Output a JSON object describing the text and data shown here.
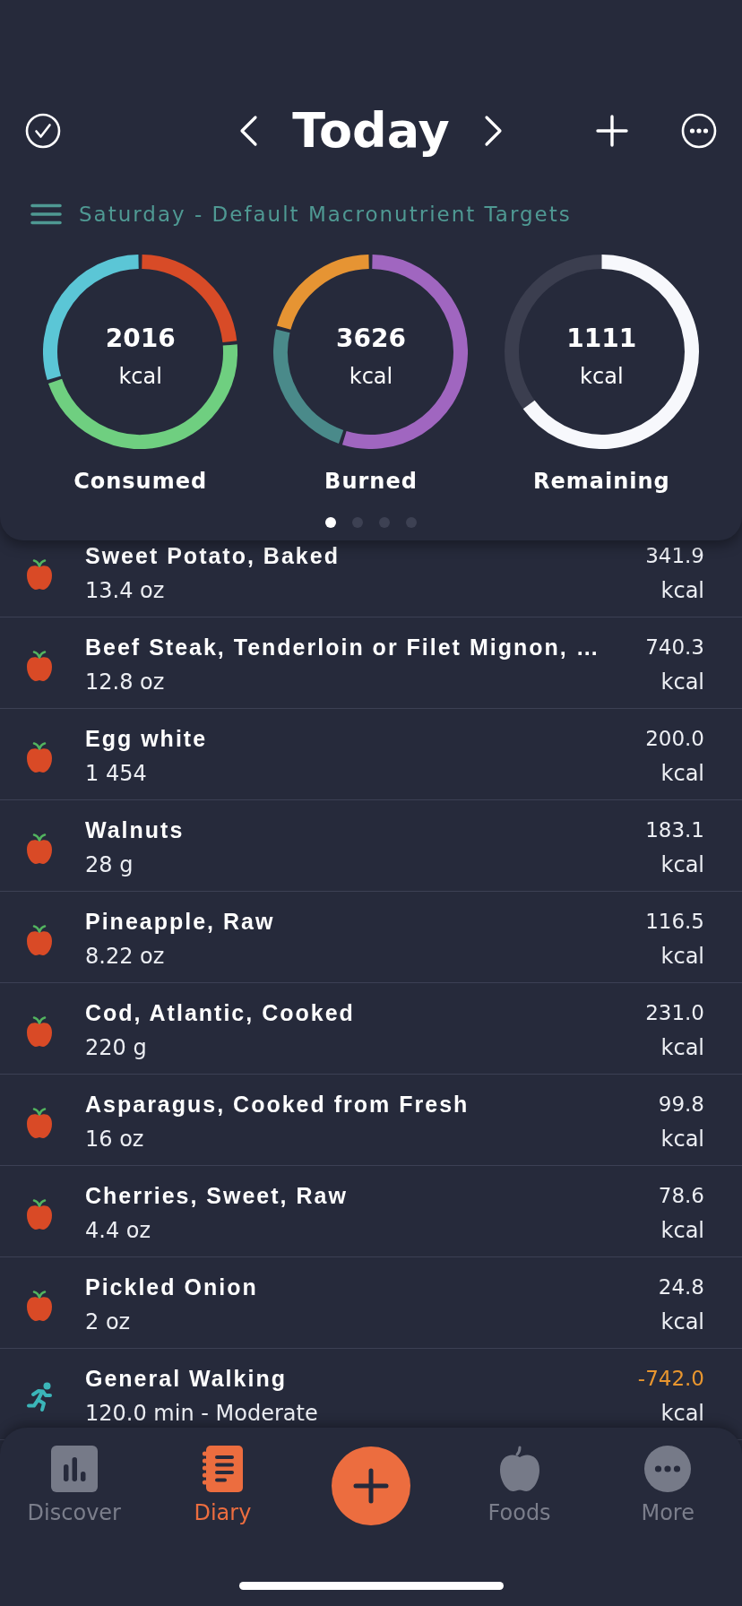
{
  "header": {
    "title": "Today",
    "subtitle": "Saturday - Default Macronutrient Targets"
  },
  "rings": [
    {
      "value": "2016",
      "unit": "kcal",
      "label": "Consumed"
    },
    {
      "value": "3626",
      "unit": "kcal",
      "label": "Burned"
    },
    {
      "value": "1111",
      "unit": "kcal",
      "label": "Remaining"
    }
  ],
  "pager": [
    {
      "selected": true
    },
    {
      "selected": false
    },
    {
      "selected": false
    },
    {
      "selected": false
    }
  ],
  "entries": [
    {
      "kind": "food",
      "name": "Sweet Potato, Baked",
      "amount": "13.4 oz",
      "calories": "341.9",
      "unit": "kcal"
    },
    {
      "kind": "food",
      "name": "Beef Steak, Tenderloin or Filet Mignon, …",
      "amount": "12.8 oz",
      "calories": "740.3",
      "unit": "kcal"
    },
    {
      "kind": "food",
      "name": "Egg white",
      "amount": "1 454",
      "calories": "200.0",
      "unit": "kcal"
    },
    {
      "kind": "food",
      "name": "Walnuts",
      "amount": "28 g",
      "calories": "183.1",
      "unit": "kcal"
    },
    {
      "kind": "food",
      "name": "Pineapple, Raw",
      "amount": "8.22 oz",
      "calories": "116.5",
      "unit": "kcal"
    },
    {
      "kind": "food",
      "name": "Cod, Atlantic, Cooked",
      "amount": "220 g",
      "calories": "231.0",
      "unit": "kcal"
    },
    {
      "kind": "food",
      "name": "Asparagus, Cooked from Fresh",
      "amount": "16 oz",
      "calories": "99.8",
      "unit": "kcal"
    },
    {
      "kind": "food",
      "name": "Cherries, Sweet, Raw",
      "amount": "4.4 oz",
      "calories": "78.6",
      "unit": "kcal"
    },
    {
      "kind": "food",
      "name": "Pickled Onion",
      "amount": "2 oz",
      "calories": "24.8",
      "unit": "kcal"
    },
    {
      "kind": "exercise",
      "name": "General Walking",
      "amount": "120.0 min - Moderate",
      "calories": "-742.0",
      "unit": "kcal"
    }
  ],
  "nav": {
    "items": [
      {
        "kind": "tab",
        "label": "Discover",
        "selected": false
      },
      {
        "kind": "tab",
        "label": "Diary",
        "selected": true
      },
      {
        "kind": "add"
      },
      {
        "kind": "tab",
        "label": "Foods",
        "selected": false
      },
      {
        "kind": "tab",
        "label": "More",
        "selected": false
      }
    ]
  }
}
